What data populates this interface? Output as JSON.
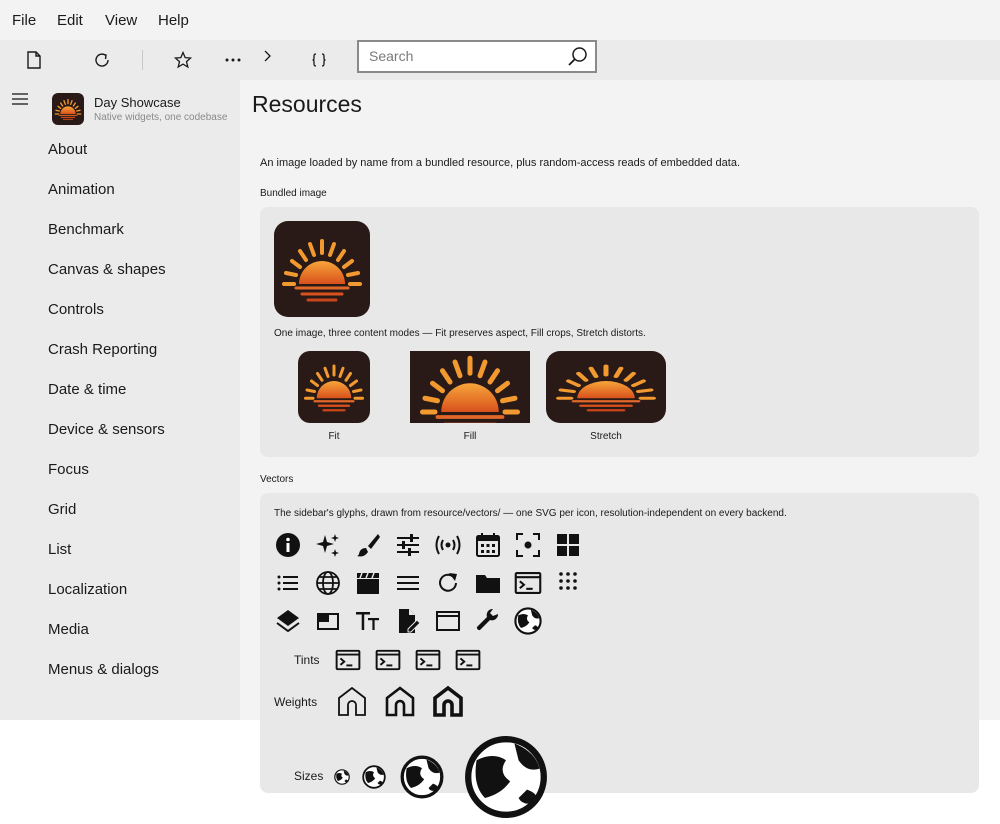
{
  "menu": {
    "file": "File",
    "edit": "Edit",
    "view": "View",
    "help": "Help"
  },
  "toolbar": {
    "search_placeholder": "Search"
  },
  "app": {
    "name": "Day Showcase",
    "tagline": "Native widgets, one codebase"
  },
  "sidebar": {
    "items": [
      {
        "label": "About"
      },
      {
        "label": "Animation"
      },
      {
        "label": "Benchmark"
      },
      {
        "label": "Canvas & shapes"
      },
      {
        "label": "Controls"
      },
      {
        "label": "Crash Reporting"
      },
      {
        "label": "Date & time"
      },
      {
        "label": "Device & sensors"
      },
      {
        "label": "Focus"
      },
      {
        "label": "Grid"
      },
      {
        "label": "List"
      },
      {
        "label": "Localization"
      },
      {
        "label": "Media"
      },
      {
        "label": "Menus & dialogs"
      }
    ]
  },
  "page": {
    "title": "Resources",
    "intro": "An image loaded by name from a bundled resource, plus random-access reads of embedded data.",
    "bundled_heading": "Bundled image",
    "modes_caption": "One image, three content modes — Fit preserves aspect, Fill crops, Stretch distorts.",
    "modes": [
      "Fit",
      "Fill",
      "Stretch"
    ],
    "vectors_heading": "Vectors",
    "vectors_caption": "The sidebar's glyphs, drawn from resource/vectors/ — one SVG per icon, resolution-independent on every backend.",
    "tints_label": "Tints",
    "weights_label": "Weights",
    "sizes_label": "Sizes"
  },
  "colors": {
    "sun_orange": "#f08a24",
    "sun_dark": "#2a1a17",
    "accent": "#e05a1a"
  }
}
